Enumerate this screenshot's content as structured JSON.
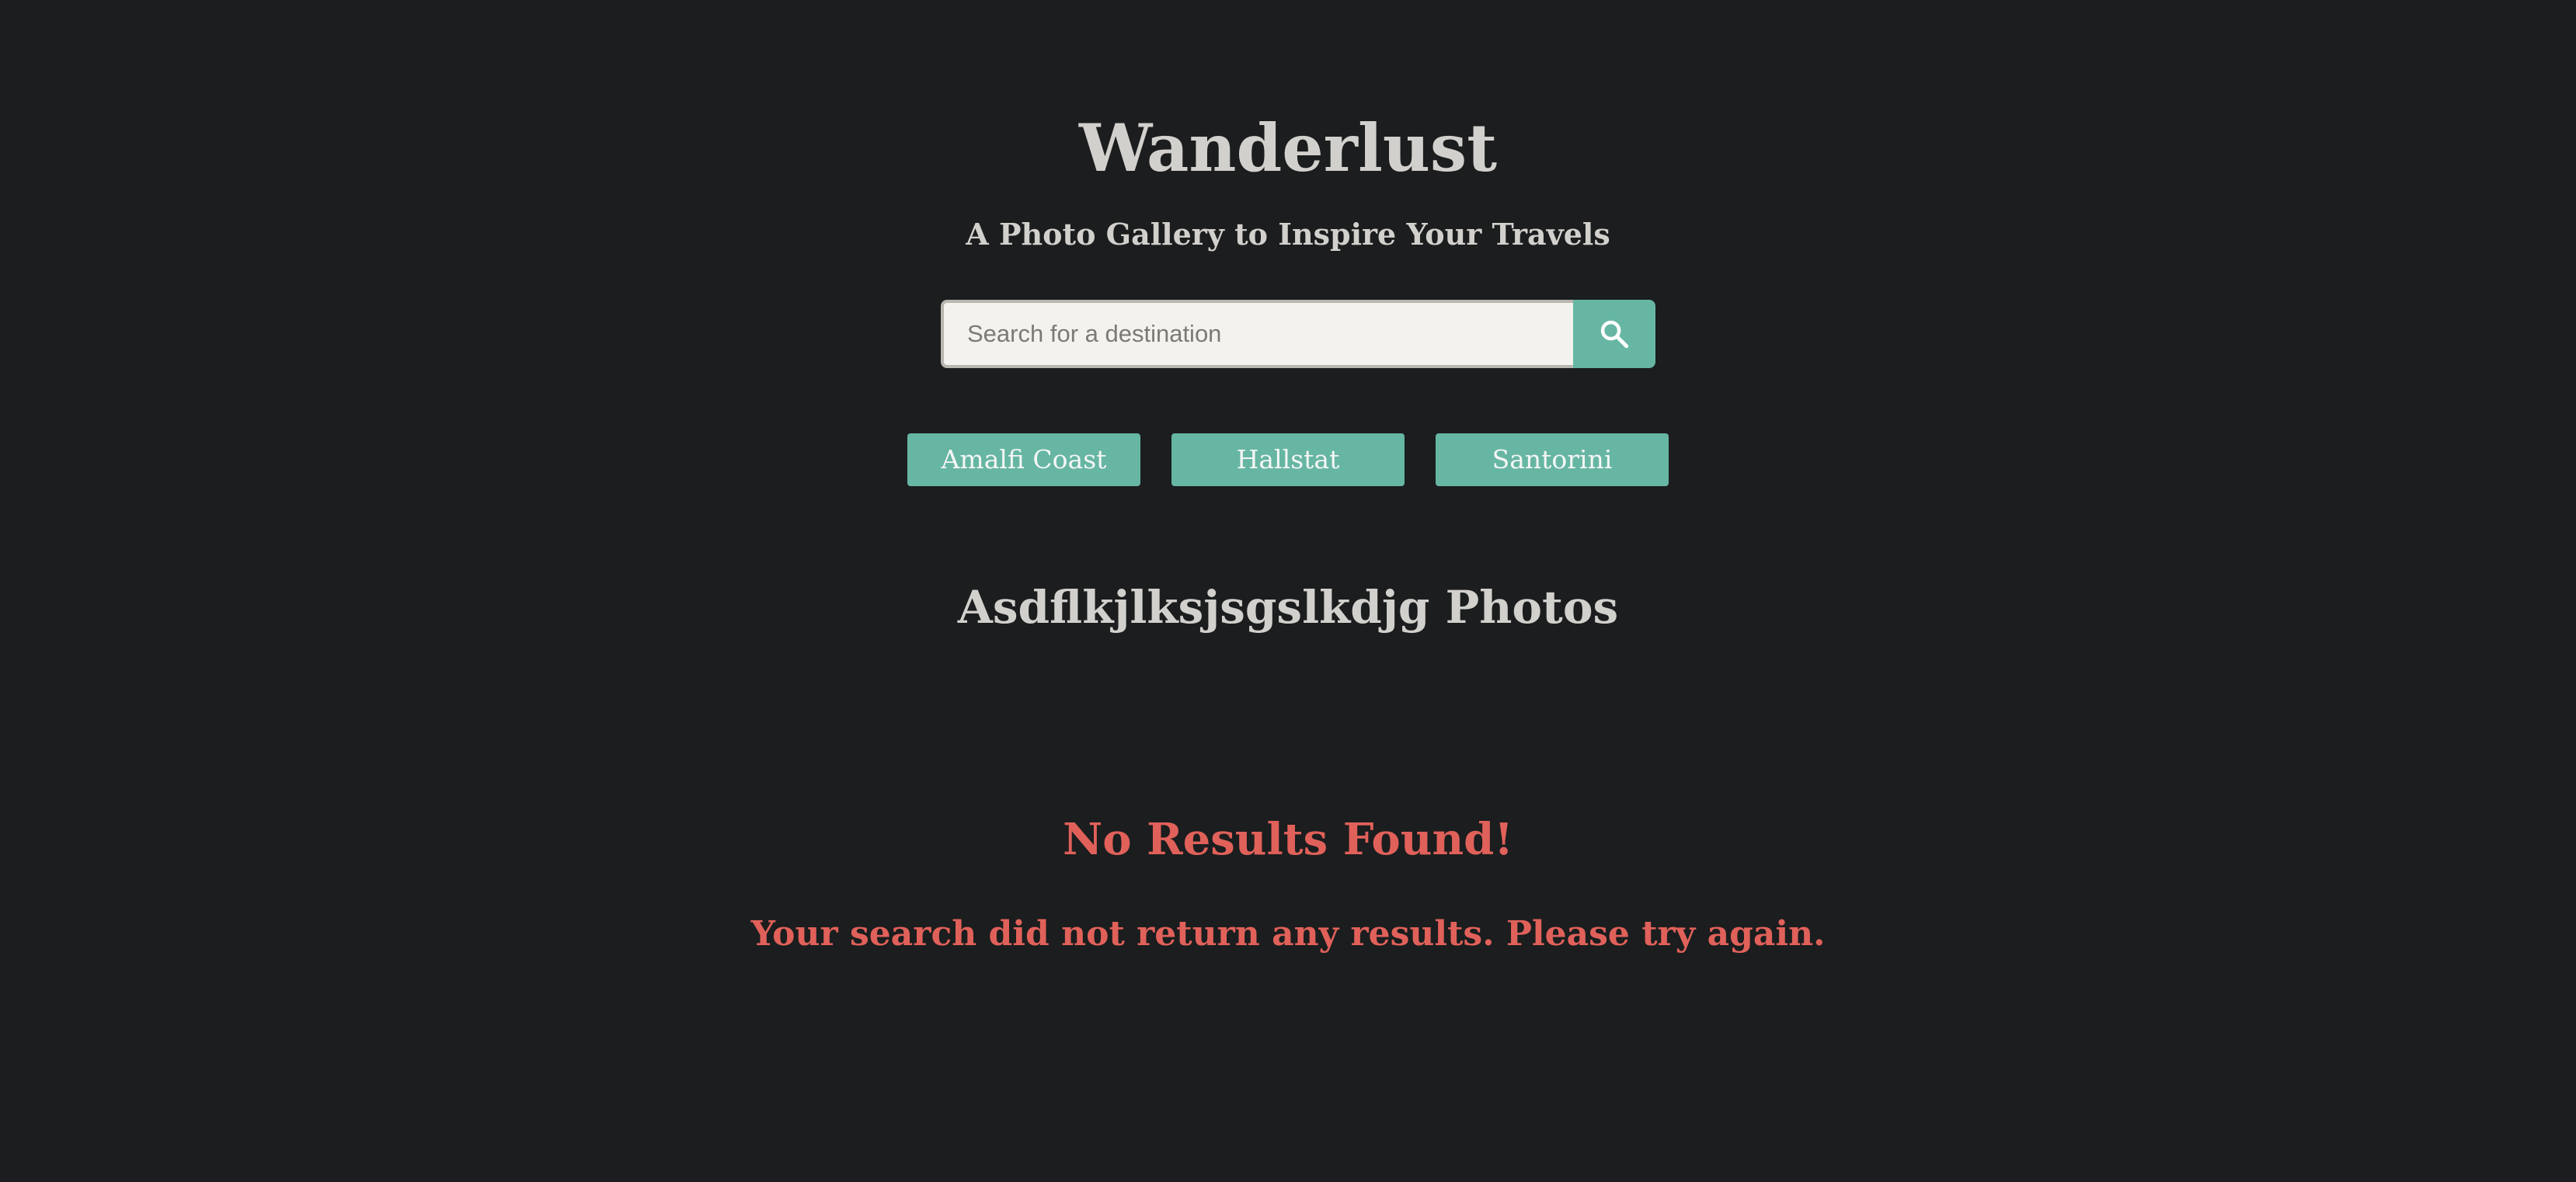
{
  "header": {
    "title": "Wanderlust",
    "subtitle": "A Photo Gallery to Inspire Your Travels"
  },
  "search": {
    "value": "",
    "placeholder": "Search for a destination",
    "button_icon": "search-icon"
  },
  "quick_links": [
    {
      "label": "Amalfi Coast"
    },
    {
      "label": "Hallstat"
    },
    {
      "label": "Santorini"
    }
  ],
  "results": {
    "heading": "Asdflkjlksjsgslkdjg Photos",
    "empty_title": "No Results Found!",
    "empty_message": "Your search did not return any results. Please try again."
  },
  "colors": {
    "background": "#1b1d1e",
    "accent": "#66b6a3",
    "error": "#e0615a",
    "text": "#d2d0cc"
  }
}
